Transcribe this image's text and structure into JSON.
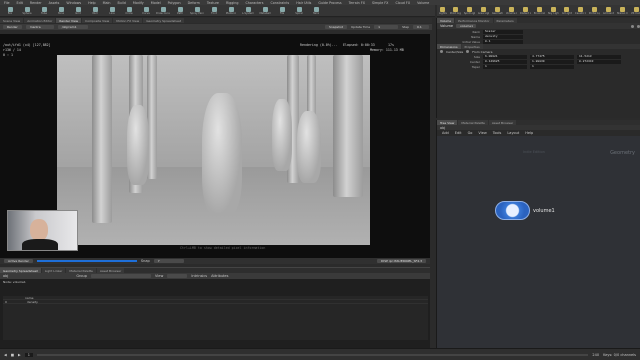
{
  "menubar": [
    "File",
    "Edit",
    "Render",
    "Assets",
    "Windows",
    "Help",
    "Main",
    "Build",
    "Modify",
    "Model",
    "Polygon",
    "Deform",
    "Texture",
    "Rigging",
    "Characters",
    "Constraints",
    "Hair Utils",
    "Guide Process",
    "Terrain FX",
    "Simple FX",
    "Cloud FX",
    "Volume"
  ],
  "shelf_tools": [
    "Box",
    "Sphere",
    "Tube",
    "Torus",
    "Grid",
    "Null",
    "Line",
    "Circle",
    "Curve",
    "Draw Curve",
    "Path",
    "Spray Paint",
    "Font",
    "Platonic",
    "L-System",
    "Metaball",
    "File",
    "Spiral",
    "Helix"
  ],
  "right_shelf_tools": [
    "Lights",
    "Point Light",
    "Spot Light",
    "Area Light",
    "Geometry Light",
    "Volume Light",
    "Distant Light",
    "Environment Light",
    "Sky Light",
    "GI Light",
    "Caustic Light",
    "Portal Light",
    "Ambient Light",
    "Stereo Camera",
    "VR Camera",
    "Switcher"
  ],
  "left_tabs": [
    "Scene View",
    "Animation Editor",
    "Render View",
    "Composite View",
    "Motion FX View",
    "Geometry Spreadsheet"
  ],
  "left_tab_active": 2,
  "render_toolbar": {
    "render_btn": "Render",
    "renderer": "mantra",
    "camera": "/obj/cam1",
    "snapshot": "Snapshot",
    "auto_update": "Auto Update",
    "update_time_label": "Update Time",
    "update_time_value": "1",
    "step_label": "Step",
    "step_value": "0.1"
  },
  "render_overlay": {
    "path": "/out/ifd1 (x4) [127,882]",
    "line2": "r136 / 14",
    "line3": "0 : 1",
    "status": "Rendering (0.0%)...",
    "elapsed": "Elapsed: 0:00:33",
    "tiles": "17s",
    "memory": "Memory: 111.13 MB"
  },
  "render_hint": "Ctrl+LMB to show detailed pixel information",
  "render_footer": {
    "active_render": "Active Render",
    "snap_label": "Snap",
    "snap_value": "7",
    "color_space": "sRGB",
    "ocio": "OCIO",
    "dither": "DISP ipr:ISSUEPANEL_SF4.3"
  },
  "spreadsheet": {
    "tabs": [
      "Geometry Spreadsheet",
      "Light Linker",
      "Material Palette",
      "Asset Browser"
    ],
    "node_label": "Node: volume1",
    "path_label": "obj",
    "group_label": "Group",
    "view_label": "View",
    "intrinsics_label": "Intrinsics",
    "attributes_label": "Attributes",
    "columns": [
      "",
      "name"
    ],
    "rows": [
      [
        "0",
        "density"
      ]
    ]
  },
  "props": {
    "tabs": [
      "Volume",
      "Performance Monitor",
      "Parameters"
    ],
    "node_type": "Volume",
    "node_name": "volume1",
    "section_tabs": [
      "Dimensions",
      "Properties"
    ],
    "fields": [
      {
        "label": "Rank",
        "value": "Scalar"
      },
      {
        "label": "Name",
        "value": "density"
      },
      {
        "label": "Initial Value",
        "value": "0.1"
      }
    ],
    "center_size_label": "Center/Size",
    "from_camera_label": "From Camera",
    "vec_fields": [
      {
        "label": "Size",
        "values": [
          "6.00021",
          "4.77475",
          "11.5213"
        ]
      },
      {
        "label": "Center",
        "values": [
          "0.149625",
          "1.88839",
          "0.272343"
        ]
      },
      {
        "label": "Taper",
        "values": [
          "1",
          "1"
        ]
      }
    ]
  },
  "network": {
    "tabs": [
      "Tree View",
      "Material Palette",
      "Asset Browser"
    ],
    "menus": [
      "Add",
      "Edit",
      "Go",
      "View",
      "Tools",
      "Layout",
      "Help"
    ],
    "path": "obj",
    "context_label": "Geometry",
    "side_label": "Indie Edition",
    "node": {
      "name": "volume1"
    }
  },
  "playbar": {
    "frame": "1",
    "end": "240",
    "realtime": "Auto Update",
    "status": "Keys: 0/0 channels"
  },
  "colors": {
    "accent": "#1e6fd9",
    "node": "#3a79d6"
  }
}
